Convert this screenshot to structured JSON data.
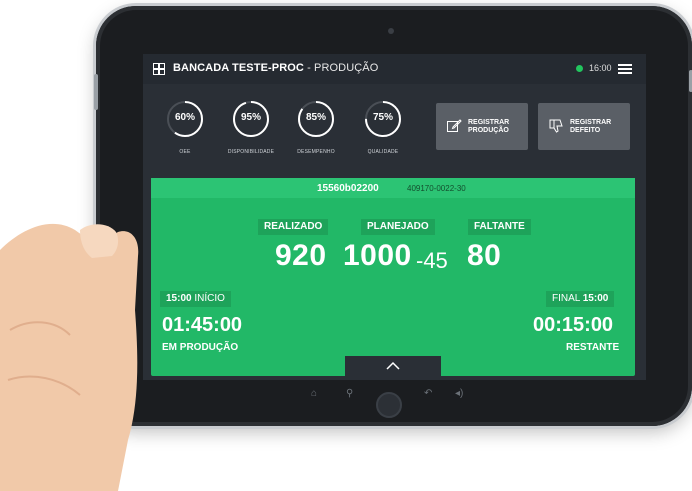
{
  "header": {
    "title": "BANCADA TESTE-PROC",
    "subtitle": " - PRODUÇÃO",
    "time": "16:00"
  },
  "gauges": [
    {
      "value": "60%",
      "label": "OEE",
      "fraction": 0.6
    },
    {
      "value": "95%",
      "label": "DISPONIBILIDADE",
      "fraction": 0.95
    },
    {
      "value": "85%",
      "label": "DESEMPENHO",
      "fraction": 0.85
    },
    {
      "value": "75%",
      "label": "QUALIDADE",
      "fraction": 0.75
    }
  ],
  "actions": {
    "register_production": "REGISTRAR PRODUÇÃO",
    "register_defect": "REGISTRAR DEFEITO"
  },
  "order": {
    "number": "15560b02200",
    "code": "409170-0022-30"
  },
  "production": {
    "realizado_label": "REALIZADO",
    "planejado_label": "PLANEJADO",
    "faltante_label": "FALTANTE",
    "realizado": "920",
    "planejado": "1000",
    "diff": "-45",
    "faltante": "80"
  },
  "timing": {
    "start_time": "15:00",
    "start_label": "INÍCIO",
    "elapsed": "01:45:00",
    "elapsed_label": "EM PRODUÇÃO",
    "end_label": "FINAL",
    "end_time": "15:00",
    "remaining": "00:15:00",
    "remaining_label": "RESTANTE"
  },
  "colors": {
    "panel": "#22b867",
    "status": "#22c55e",
    "screen": "#2a2f36"
  }
}
